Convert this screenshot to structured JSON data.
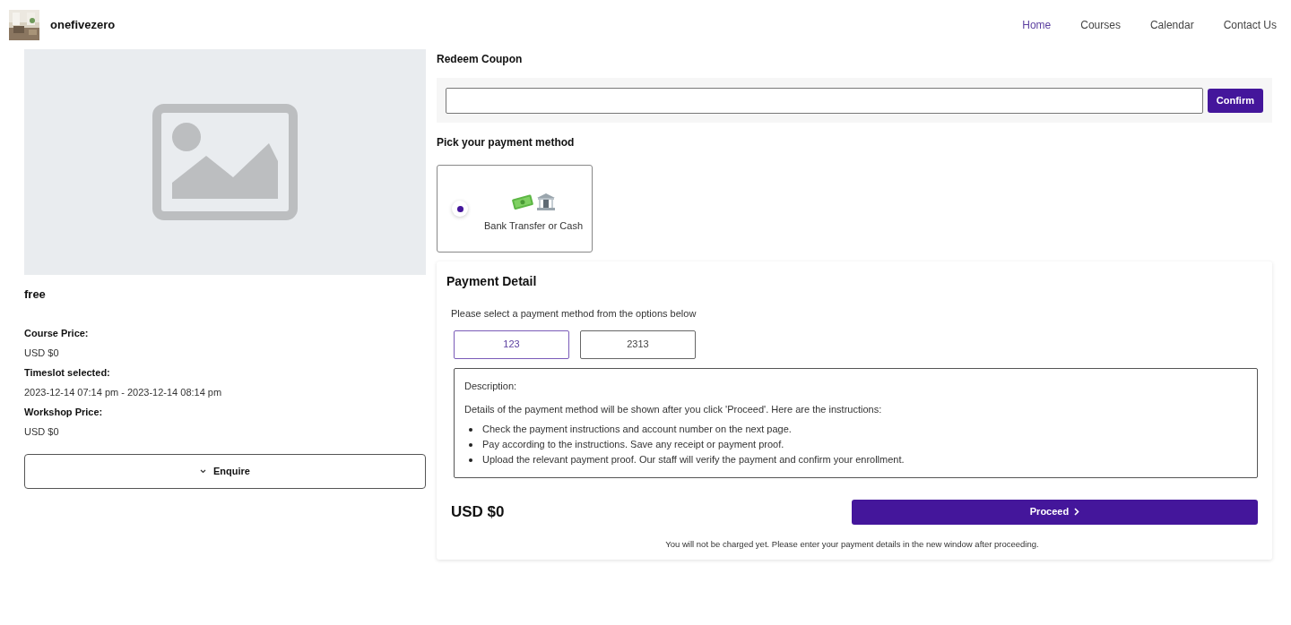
{
  "header": {
    "brand": "onefivezero",
    "nav": [
      {
        "label": "Home",
        "selected": true
      },
      {
        "label": "Courses",
        "selected": false
      },
      {
        "label": "Calendar",
        "selected": false
      },
      {
        "label": "Contact Us",
        "selected": false
      }
    ]
  },
  "course": {
    "title": "free",
    "details": [
      {
        "label": "Course Price:",
        "value": "USD $0"
      },
      {
        "label": "Timeslot selected:",
        "value": "2023-12-14 07:14 pm - 2023-12-14 08:14 pm"
      },
      {
        "label": "Workshop Price:",
        "value": "USD $0"
      }
    ],
    "enquire_button": "Enquire"
  },
  "coupon": {
    "title": "Redeem Coupon",
    "button": "Confirm"
  },
  "payment_methods": {
    "title": "Pick your payment method",
    "items": [
      {
        "label": "Bank Transfer or Cash",
        "selected": true
      }
    ]
  },
  "payment_detail": {
    "title": "Payment Detail",
    "prompt": "Please select a payment method from the options below",
    "options": [
      {
        "label": "123",
        "selected": true
      },
      {
        "label": "2313",
        "selected": false
      }
    ],
    "description_title": "Description:",
    "description_text": "Details of the payment method will be shown after you click 'Proceed'. Here are the instructions:",
    "instructions": [
      "Check the payment instructions and account number on the next page.",
      "Pay according to the instructions. Save any receipt or payment proof.",
      "Upload the relevant payment proof. Our staff will verify the payment and confirm your enrollment."
    ],
    "total": "USD $0",
    "proceed_button": "Proceed",
    "note": "You will not be charged yet. Please enter your payment details in the new window after proceeding."
  }
}
